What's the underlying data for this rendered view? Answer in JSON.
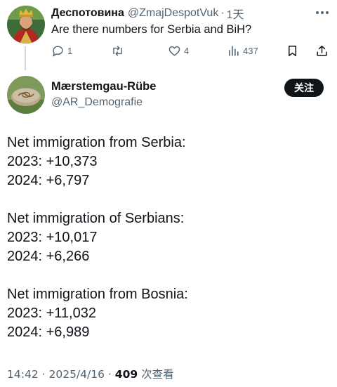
{
  "reply": {
    "display_name": "Деспотовина",
    "handle": "@ZmajDespotVuk",
    "separator": "·",
    "time": "1天",
    "text": "Are there numbers for Serbia and BiH?",
    "more_icon": "more-horizontal-icon",
    "actions": {
      "reply_count": "1",
      "retweet_count": "",
      "like_count": "4",
      "view_count": "437"
    }
  },
  "tweet": {
    "display_name": "Mærstemgau-Rübe",
    "handle": "@AR_Demografie",
    "follow_label": "关注",
    "sections": [
      {
        "heading": "Net immigration from Serbia:",
        "lines": [
          "2023: +10,373",
          "2024: +6,797"
        ]
      },
      {
        "heading": "Net immigration of Serbians:",
        "lines": [
          "2023: +10,017",
          "2024: +6,266"
        ]
      },
      {
        "heading": "Net immigration from Bosnia:",
        "lines": [
          "2023: +11,032",
          "2024: +6,989"
        ]
      }
    ],
    "meta": {
      "time": "14:42",
      "separator": "·",
      "date": "2025/4/16",
      "separator2": "·",
      "views": "409",
      "views_label": "次查看"
    }
  },
  "colors": {
    "text": "#0f1419",
    "secondary": "#536471",
    "thread_line": "#cfd9de",
    "follow_bg": "#0f1419"
  }
}
